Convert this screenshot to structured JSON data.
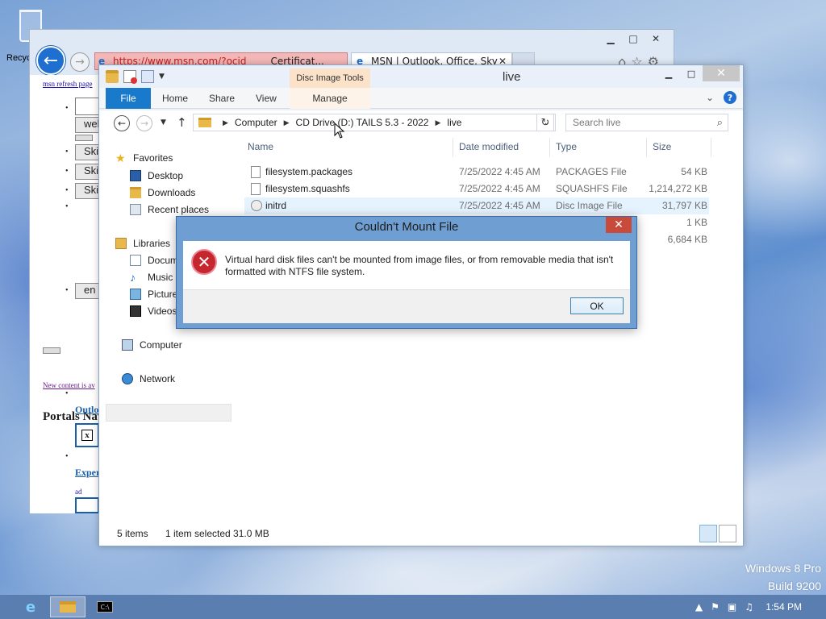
{
  "desktop": {
    "recycle_label": "Recyc",
    "watermark": [
      "Windows 8 Pro",
      "Build 9200"
    ]
  },
  "ie": {
    "address": "https://www.msn.com/?ocid",
    "cert_label": "Certificat...",
    "tab_title": "MSN | Outlook, Office, Sky",
    "content": {
      "refresh_link": "msn refresh page",
      "buttons": [
        "wel",
        "Ski",
        "Ski",
        "Ski",
        "en"
      ],
      "new_content": "New content is av",
      "portals_heading": "Portals Nav",
      "outlook_link": "Outlo",
      "experience_link": "Exper",
      "ad_label": "ad"
    }
  },
  "explorer": {
    "title": "live",
    "context_tab_group": "Disc Image Tools",
    "ribbon_tabs": [
      "File",
      "Home",
      "Share",
      "View",
      "Manage"
    ],
    "breadcrumb": [
      "Computer",
      "CD Drive (D:) TAILS 5.3 - 2022",
      "live"
    ],
    "search_placeholder": "Search live",
    "nav": {
      "favorites": "Favorites",
      "desktop": "Desktop",
      "downloads": "Downloads",
      "recent": "Recent places",
      "libraries": "Libraries",
      "documents": "Docum",
      "music": "Music",
      "pictures": "Picture",
      "videos": "Videos",
      "computer": "Computer",
      "network": "Network"
    },
    "columns": [
      "Name",
      "Date modified",
      "Type",
      "Size"
    ],
    "files": [
      {
        "name": "filesystem.packages",
        "date": "7/25/2022 4:45 AM",
        "type": "PACKAGES File",
        "size": "54 KB"
      },
      {
        "name": "filesystem.squashfs",
        "date": "7/25/2022 4:45 AM",
        "type": "SQUASHFS File",
        "size": "1,214,272 KB"
      },
      {
        "name": "initrd",
        "date": "7/25/2022 4:45 AM",
        "type": "Disc Image File",
        "size": "31,797 KB"
      },
      {
        "name": "",
        "date": "",
        "type": "",
        "size": "1 KB"
      },
      {
        "name": "",
        "date": "",
        "type": "",
        "size": "6,684 KB"
      }
    ],
    "status": {
      "count": "5 items",
      "selection": "1 item selected  31.0 MB"
    }
  },
  "dialog": {
    "title": "Couldn't Mount File",
    "message": "Virtual hard disk files can't be mounted from image files, or from removable media that isn't formatted with NTFS file system.",
    "ok_label": "OK"
  },
  "taskbar": {
    "clock": "1:54 PM"
  },
  "colors": {
    "accent": "#1979ca",
    "context_tab": "#fbe2c8",
    "dialog_frame": "#6f9ed2",
    "close_button": "#c74a3a",
    "error_icon": "#c6262e"
  }
}
